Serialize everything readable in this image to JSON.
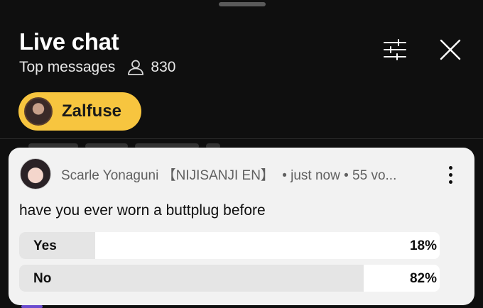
{
  "header": {
    "title": "Live chat",
    "mode_label": "Top messages",
    "viewer_count": "830"
  },
  "pinned_user": {
    "name": "Zalfuse",
    "pill_color": "#f7c53f"
  },
  "poll": {
    "author": "Scarle Yonaguni 【NIJISANJI EN】",
    "meta": "• just now • 55 vo...",
    "question": "have you ever worn a buttplug before",
    "options": [
      {
        "label": "Yes",
        "percent_text": "18%",
        "fraction": 0.18
      },
      {
        "label": "No",
        "percent_text": "82%",
        "fraction": 0.82
      }
    ]
  },
  "icons": {
    "viewer": "person-icon",
    "filter": "sliders-icon",
    "close": "close-icon",
    "more": "more-vert-icon"
  }
}
